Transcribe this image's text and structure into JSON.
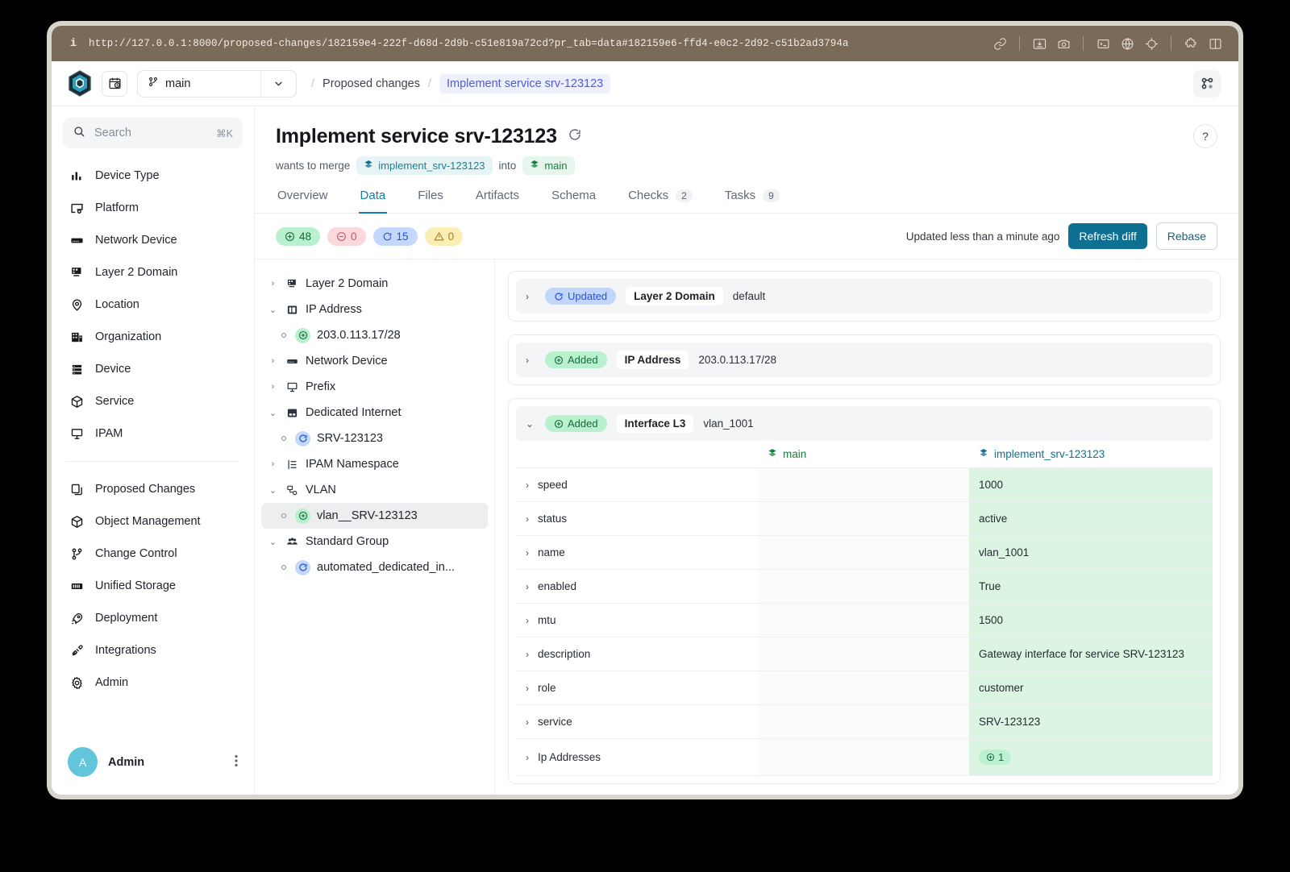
{
  "browser": {
    "url": "http://127.0.0.1:8000/proposed-changes/182159e4-222f-d68d-2d9b-c51e819a72cd?pr_tab=data#182159e6-ffd4-e0c2-2d92-c51b2ad3794a",
    "info_icon": "info-icon",
    "tools": [
      "link-icon",
      "download-icon",
      "camera-icon",
      "terminal-icon",
      "globe-icon",
      "target-icon",
      "puzzle-icon",
      "split-pane-icon"
    ]
  },
  "appnav": {
    "logo": "infrahub-logo",
    "calendar_button": "calendar-clock-icon",
    "branch": "main",
    "breadcrumb": {
      "parent": "Proposed changes",
      "current": "Implement service srv-123123",
      "separator": "/"
    },
    "grid_button": "graph-view-icon"
  },
  "sidebar": {
    "search": {
      "placeholder": "Search",
      "shortcut": "⌘K"
    },
    "items": [
      {
        "label": "Device Type",
        "icon": "bar-chart-icon"
      },
      {
        "label": "Platform",
        "icon": "platform-icon"
      },
      {
        "label": "Network Device",
        "icon": "router-icon"
      },
      {
        "label": "Layer 2 Domain",
        "icon": "layer2-icon"
      },
      {
        "label": "Location",
        "icon": "map-pin-icon"
      },
      {
        "label": "Organization",
        "icon": "building-icon"
      },
      {
        "label": "Device",
        "icon": "server-icon"
      },
      {
        "label": "Service",
        "icon": "cube-icon"
      },
      {
        "label": "IPAM",
        "icon": "ipam-icon"
      }
    ],
    "items2": [
      {
        "label": "Proposed Changes",
        "icon": "copy-icon"
      },
      {
        "label": "Object Management",
        "icon": "box-icon"
      },
      {
        "label": "Change Control",
        "icon": "branch-icon"
      },
      {
        "label": "Unified Storage",
        "icon": "storage-icon"
      },
      {
        "label": "Deployment",
        "icon": "rocket-icon"
      },
      {
        "label": "Integrations",
        "icon": "plug-icon"
      },
      {
        "label": "Admin",
        "icon": "gear-icon"
      }
    ],
    "user": {
      "initial": "A",
      "name": "Admin",
      "menu_icon": "kebab-menu-icon"
    }
  },
  "main": {
    "title": "Implement service srv-123123",
    "title_refresh_icon": "refresh-icon",
    "help_label": "?",
    "merge_prefix": "wants to merge",
    "source_branch": "implement_srv-123123",
    "merge_into": "into",
    "target_branch": "main",
    "tabs": [
      {
        "label": "Overview",
        "count": ""
      },
      {
        "label": "Data",
        "count": ""
      },
      {
        "label": "Files",
        "count": ""
      },
      {
        "label": "Artifacts",
        "count": ""
      },
      {
        "label": "Schema",
        "count": ""
      },
      {
        "label": "Checks",
        "count": "2"
      },
      {
        "label": "Tasks",
        "count": "9"
      }
    ],
    "active_tab": "Data",
    "badges": [
      {
        "kind": "add",
        "icon": "plus-circle-icon",
        "value": "48"
      },
      {
        "kind": "rem",
        "icon": "minus-circle-icon",
        "value": "0"
      },
      {
        "kind": "upd",
        "icon": "refresh-icon",
        "value": "15"
      },
      {
        "kind": "warn",
        "icon": "warning-icon",
        "value": "0"
      }
    ],
    "updated_text": "Updated less than a minute ago",
    "refresh_diff_label": "Refresh diff",
    "rebase_label": "Rebase"
  },
  "tree": [
    {
      "label": "Layer 2 Domain",
      "icon": "layer2-icon",
      "state": "collapsed",
      "level": 0
    },
    {
      "label": "IP Address",
      "icon": "ip-address-icon",
      "state": "expanded",
      "level": 0
    },
    {
      "label": "203.0.113.17/28",
      "icon": "",
      "state": "leaf",
      "level": 1,
      "dot": "add"
    },
    {
      "label": "Network Device",
      "icon": "router-icon",
      "state": "collapsed",
      "level": 0
    },
    {
      "label": "Prefix",
      "icon": "prefix-icon",
      "state": "collapsed",
      "level": 0
    },
    {
      "label": "Dedicated Internet",
      "icon": "dedicated-internet-icon",
      "state": "expanded",
      "level": 0
    },
    {
      "label": "SRV-123123",
      "icon": "",
      "state": "leaf",
      "level": 1,
      "dot": "upd"
    },
    {
      "label": "IPAM Namespace",
      "icon": "namespace-icon",
      "state": "collapsed",
      "level": 0
    },
    {
      "label": "VLAN",
      "icon": "vlan-icon",
      "state": "expanded",
      "level": 0
    },
    {
      "label": "vlan__SRV-123123",
      "icon": "",
      "state": "leaf",
      "level": 1,
      "dot": "add",
      "selected": true
    },
    {
      "label": "Standard Group",
      "icon": "group-icon",
      "state": "expanded",
      "level": 0
    },
    {
      "label": "automated_dedicated_in...",
      "icon": "",
      "state": "leaf",
      "level": 1,
      "dot": "upd"
    }
  ],
  "diff_cards": [
    {
      "state": "Updated",
      "state_kind": "updated",
      "kind": "Layer 2 Domain",
      "name": "default",
      "expanded": false
    },
    {
      "state": "Added",
      "state_kind": "added",
      "kind": "IP Address",
      "name": "203.0.113.17/28",
      "expanded": false
    },
    {
      "state": "Added",
      "state_kind": "added",
      "kind": "Interface L3",
      "name": "vlan_1001",
      "expanded": true
    }
  ],
  "diff_table": {
    "columns": [
      "",
      "main",
      "implement_srv-123123"
    ],
    "rows": [
      {
        "attr": "speed",
        "main": "",
        "branch": "1000"
      },
      {
        "attr": "status",
        "main": "",
        "branch": "active"
      },
      {
        "attr": "name",
        "main": "",
        "branch": "vlan_1001"
      },
      {
        "attr": "enabled",
        "main": "",
        "branch": "True"
      },
      {
        "attr": "mtu",
        "main": "",
        "branch": "1500"
      },
      {
        "attr": "description",
        "main": "",
        "branch": "Gateway interface for service SRV-123123"
      },
      {
        "attr": "role",
        "main": "",
        "branch": "customer"
      },
      {
        "attr": "service",
        "main": "",
        "branch": "SRV-123123"
      },
      {
        "attr": "Ip Addresses",
        "main": "",
        "branch": "1",
        "branch_is_pill": true
      }
    ]
  },
  "colors": {
    "accent": "#0d7fa8",
    "primary_button": "#0d6f92",
    "added_bg": "#dcf4e2",
    "added_text": "#177a42",
    "branch_link": "#13718f",
    "main_branch": "#15803d",
    "urlbar_bg": "#7a6a58",
    "breadcrumb_active": "#4f5dd8"
  }
}
